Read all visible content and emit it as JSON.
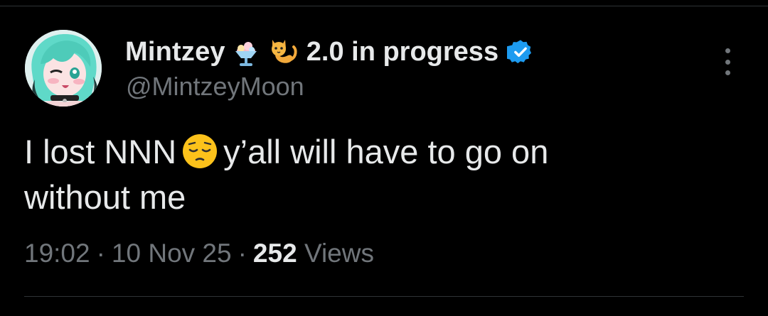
{
  "tweet": {
    "author": {
      "display_name": "Mintzey",
      "display_name_suffix": "2.0 in progress",
      "name_emojis": [
        "shaved-ice-icon",
        "cat-icon"
      ],
      "verified": true,
      "handle": "@MintzeyMoon",
      "avatar_icon": "anime-avatar-icon"
    },
    "text_line1_before_emoji": "I lost NNN",
    "text_emoji": "pensive-face-icon",
    "text_line1_after_emoji": "y’all will have to go on",
    "text_line2": "without me",
    "time": "19:02",
    "date": "10 Nov 25",
    "views_count": "252",
    "views_label": "Views",
    "separator": "·"
  },
  "colors": {
    "background": "#000000",
    "primary_text": "#e7e9ea",
    "secondary_text": "#71767b",
    "verified_blue": "#1d9bf0",
    "divider": "#2f3336"
  }
}
